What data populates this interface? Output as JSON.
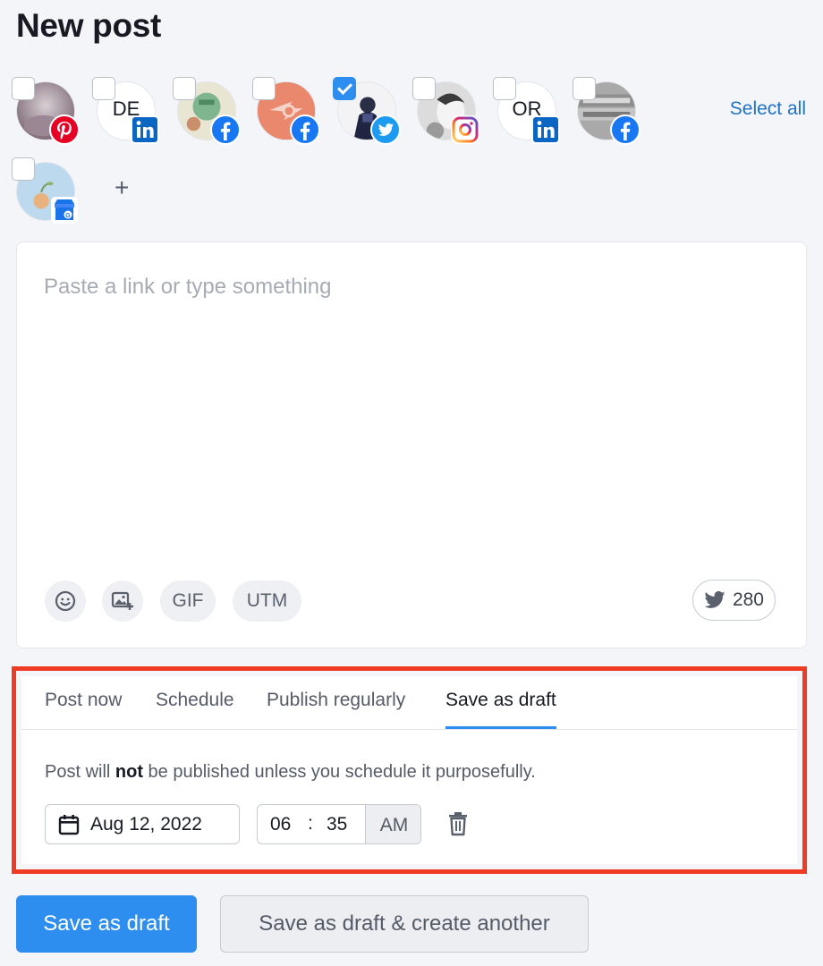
{
  "page": {
    "title": "New post"
  },
  "accounts": [
    {
      "network": "pinterest",
      "checked": false,
      "initials": ""
    },
    {
      "network": "linkedin",
      "checked": false,
      "initials": "DE"
    },
    {
      "network": "facebook",
      "checked": false,
      "initials": ""
    },
    {
      "network": "facebook",
      "checked": false,
      "initials": ""
    },
    {
      "network": "twitter",
      "checked": true,
      "initials": ""
    },
    {
      "network": "instagram",
      "checked": false,
      "initials": ""
    },
    {
      "network": "linkedin",
      "checked": false,
      "initials": "OR"
    },
    {
      "network": "facebook",
      "checked": false,
      "initials": ""
    },
    {
      "network": "google-business",
      "checked": false,
      "initials": ""
    }
  ],
  "accounts_bar": {
    "select_all_label": "Select all",
    "add_label": "+"
  },
  "composer": {
    "placeholder": "Paste a link or type something",
    "gif_label": "GIF",
    "utm_label": "UTM",
    "char_count": "280",
    "icons": [
      "emoji-icon",
      "image-add-icon",
      "twitter-icon"
    ]
  },
  "publish": {
    "tabs": [
      "Post now",
      "Schedule",
      "Publish regularly",
      "Save as draft"
    ],
    "active_tab": "Save as draft",
    "notice_before": "Post will ",
    "notice_bold": "not",
    "notice_after": " be published unless you schedule it purposefully.",
    "date": "Aug 12, 2022",
    "hour": "06",
    "time_separator": ":",
    "minute": "35",
    "ampm": "AM"
  },
  "footer": {
    "primary_label": "Save as draft",
    "secondary_label": "Save as draft & create another"
  },
  "colors": {
    "accent": "#2d8ef0",
    "highlight": "#ef3a24",
    "link": "#1f72c4",
    "pinterest": "#e60023",
    "linkedin": "#0a66c2",
    "facebook": "#1877f2",
    "twitter": "#1d9bf0"
  }
}
